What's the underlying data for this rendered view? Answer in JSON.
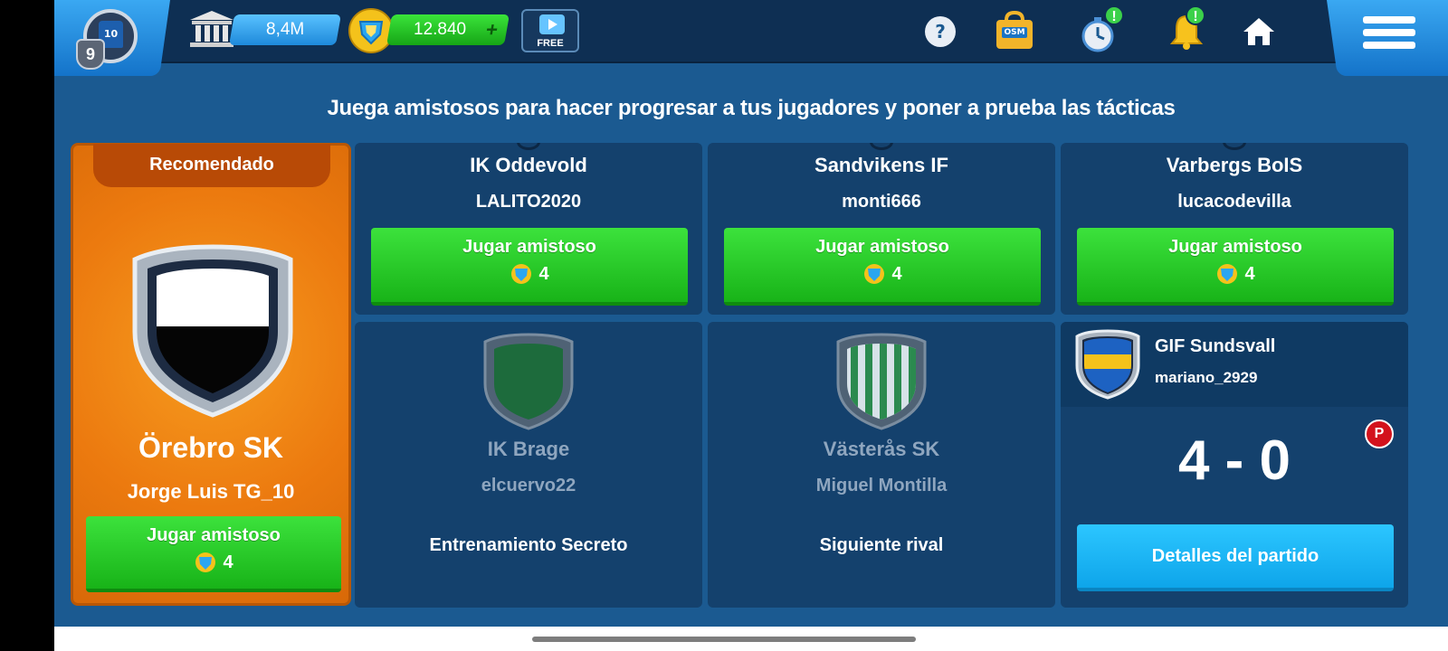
{
  "header": {
    "player_number": "10",
    "player_level": "9",
    "money": "8,4M",
    "coins": "12.840",
    "coins_add": "+",
    "free_label": "FREE",
    "help_icon": "question-icon",
    "shop_icon": "bag-icon",
    "shop_label": "OSM",
    "timer_icon": "stopwatch-icon",
    "bell_icon": "bell-icon",
    "home_icon": "home-icon",
    "menu_icon": "menu-icon",
    "notif_mark": "!"
  },
  "subtitle": "Juega amistosos para hacer progresar a tus jugadores y poner a prueba las tácticas",
  "recommended": {
    "tag": "Recomendado",
    "team": "Örebro SK",
    "manager": "Jorge Luis TG_10",
    "button": "Jugar amistoso",
    "cost": "4"
  },
  "friendlies": [
    {
      "team": "IK Oddevold",
      "manager": "LALITO2020",
      "button": "Jugar amistoso",
      "cost": "4"
    },
    {
      "team": "Sandvikens IF",
      "manager": "monti666",
      "button": "Jugar amistoso",
      "cost": "4"
    },
    {
      "team": "Varbergs BoIS",
      "manager": "lucacodevilla",
      "button": "Jugar amistoso",
      "cost": "4"
    }
  ],
  "locked": [
    {
      "team": "IK Brage",
      "manager": "elcuervo22",
      "caption": "Entrenamiento Secreto"
    },
    {
      "team": "Västerås SK",
      "manager": "Miguel Montilla",
      "caption": "Siguiente rival"
    }
  ],
  "last_result": {
    "team": "GIF Sundsvall",
    "manager": "mariano_2929",
    "score": "4 - 0",
    "badge": "P",
    "button": "Detalles del partido"
  },
  "colors": {
    "background": "#1b5a91",
    "card": "#14416d",
    "green_button": "#22c822",
    "blue_button": "#1cb5f5",
    "orange_card": "#ec7a0f"
  }
}
